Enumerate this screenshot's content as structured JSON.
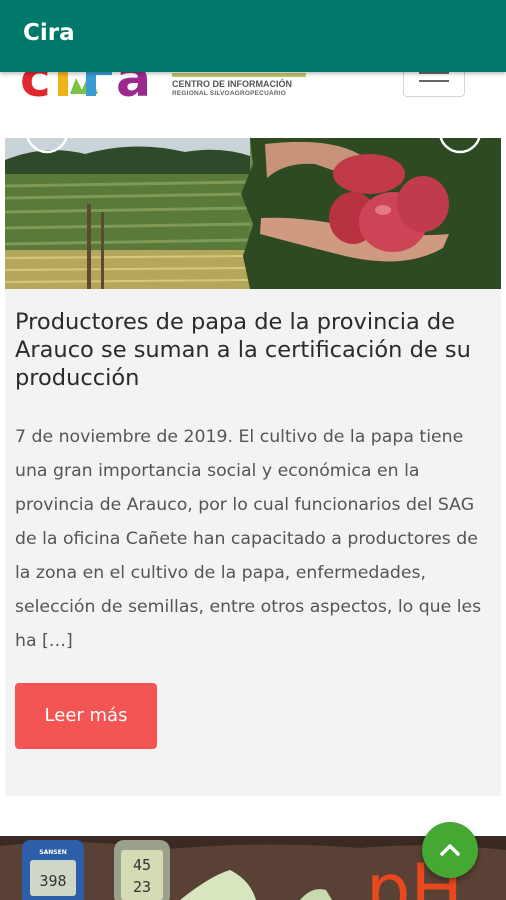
{
  "appbar": {
    "title": "Cira"
  },
  "site_header": {
    "logo_text": "cira",
    "logo_line1": "CENTRO DE INFORMACIÓN",
    "logo_line2": "REGIONAL SILVOAGROPECUARIO",
    "menu_icon": "hamburger-icon"
  },
  "article": {
    "image_icons": [
      "chevron-left-icon",
      "chevron-right-icon"
    ],
    "title": "Productores de papa de la provincia de Arauco se suman a la certificación de su producción",
    "excerpt": "7 de noviembre de 2019. El cultivo de la papa tiene una gran importancia social y económica en la provincia de Arauco, por lo cual funcionarios del SAG de la oficina Cañete han capacitado a productores de la zona en el cultivo de la papa, enfermedades, selección de semillas, entre otros aspectos, lo que les ha […]",
    "read_more_label": "Leer más"
  },
  "next_article": {
    "meter1_brand": "SANSEN",
    "meter1_value": "398",
    "meter2_top": "45",
    "meter2_bottom": "23",
    "ph_text": "pH"
  },
  "fab": {
    "icon": "chevron-up-icon"
  },
  "colors": {
    "appbar": "#00796b",
    "button": "#f25553",
    "fab": "#44a832",
    "card_bg": "#f3f3f3"
  }
}
